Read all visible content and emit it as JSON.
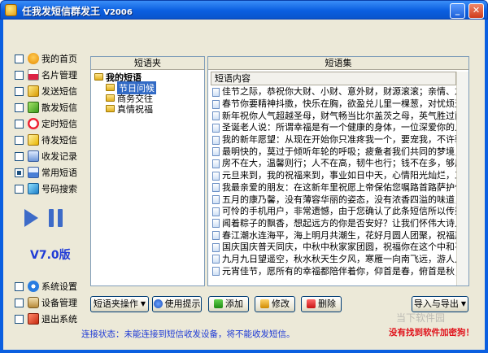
{
  "window": {
    "title": "任我发短信群发王",
    "version": "V2006",
    "minimize_glyph": "_",
    "close_glyph": "✕"
  },
  "sidebar": {
    "items": [
      {
        "label": "我的首页",
        "icon": "home-icon",
        "checked": false
      },
      {
        "label": "名片管理",
        "icon": "card-icon",
        "checked": false
      },
      {
        "label": "发送短信",
        "icon": "send-icon",
        "checked": false
      },
      {
        "label": "散发短信",
        "icon": "bulk-send-icon",
        "checked": false
      },
      {
        "label": "定时短信",
        "icon": "clock-icon",
        "checked": false
      },
      {
        "label": "待发短信",
        "icon": "pending-icon",
        "checked": false
      },
      {
        "label": "收发记录",
        "icon": "record-icon",
        "checked": false
      },
      {
        "label": "常用短语",
        "icon": "phrases-icon",
        "checked": true
      },
      {
        "label": "号码搜索",
        "icon": "phone-search-icon",
        "checked": false
      }
    ],
    "bottom_items": [
      {
        "label": "系统设置",
        "icon": "settings-icon",
        "checked": false
      },
      {
        "label": "设备管理",
        "icon": "device-icon",
        "checked": false
      },
      {
        "label": "退出系统",
        "icon": "exit-icon",
        "checked": false
      }
    ],
    "version_label": "V7.0版"
  },
  "folder_panel": {
    "header": "短语夹",
    "tree": {
      "root": "我的短语",
      "children": [
        "节日问候",
        "商务交往",
        "真情祝福"
      ],
      "selected_index": 0
    }
  },
  "sms_panel": {
    "header": "短语集",
    "column_header": "短语内容",
    "items": [
      "佳节之际，恭祝你大财、小财、意外财，财源滚滚；亲情、友情、爱情",
      "春节你要精神抖擞，快乐在胸，欲盈兑儿里一棵葱，对忧烦无动于衷",
      "新年祝你人气超越圣母，财气畅当比尔盖茨之母，英气胜过萨达姆",
      "圣诞老人说：所谓幸福是有一个健康的身体，一位深爱你的人，一",
      "我的新年愿望：从现在开始你只准疼我一个，要宠我，不许骗我，",
      "最明快的，莫过于倾听年轮的呼吸；疲惫者我们共同的梦境，你我",
      "房不在大，温馨则行；人不在高，韧牛也行；钱不在多，够用就行；",
      "元旦来到，我的祝福来到，事业如日中天，心情阳光灿烂，工资地",
      "我最亲爱的朋友：在这新年里祝愿上帝保佑您嘱路首路萨护住您财",
      "五月的康乃馨，没有薄容华丽的姿态，没有浓香四溢的味道，只是",
      "可怜的手机用户，非常遗憾，由于您确认了此条短信所以传染了恶",
      "闻着粽子的飘香，想起远方的你是否安好？让我们怀伟大诗人的福",
      "春江潮水连海平，海上明月共潮生，花好月圆人团聚，祝福声声伴",
      "国庆国庆普天同庆，中秋中秋家家团圆，祝福你在这个中和平幸福的",
      "九月九日望遥空，秋水秋天生夕风，寒雁一向南飞远，游人几度菊",
      "元宵佳节，愿所有的幸福都陪伴着你，仰首是春，俯首是秋；愿所"
    ]
  },
  "toolbar": {
    "folder_ops_label": "短语夹操作",
    "help_label": "使用提示",
    "add_label": "添加",
    "edit_label": "修改",
    "delete_label": "删除",
    "import_export_label": "导入与导出"
  },
  "status": {
    "connection": "连接状态：未能连接到短信收发设备，将不能收发短信。",
    "warning": "没有找到软件加密狗！"
  },
  "watermark": "当下软件园"
}
